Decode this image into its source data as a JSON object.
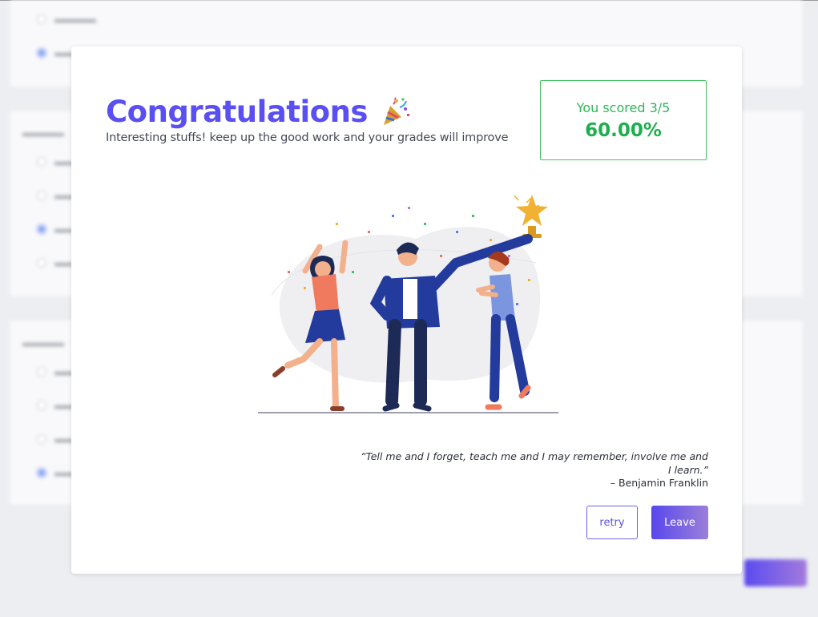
{
  "modal": {
    "title": "Congratulations",
    "subtitle": "Interesting stuffs! keep up the good work and your grades will improve",
    "score_label": "You scored 3/5",
    "score_percent": "60.00%",
    "quote": "“Tell me and I forget, teach me and I may remember, involve me and I learn.”",
    "quote_author": "– Benjamin Franklin",
    "retry_label": "retry",
    "leave_label": "Leave"
  },
  "colors": {
    "title": "#5a4ff3",
    "score_green": "#1eae4d",
    "leave_gradient_start": "#5848ec",
    "leave_gradient_end": "#9b7fd9"
  },
  "icons": {
    "title_icon": "party-popper-icon",
    "illustration": "celebration-trophy-illustration"
  }
}
